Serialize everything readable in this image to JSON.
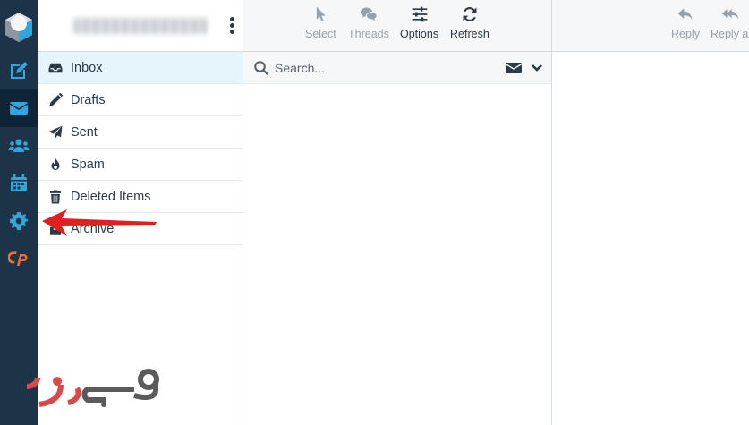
{
  "rail": {
    "items": [
      {
        "name": "compose",
        "icon": "edit-square-icon"
      },
      {
        "name": "mail",
        "icon": "envelope-icon"
      },
      {
        "name": "contacts",
        "icon": "users-icon"
      },
      {
        "name": "calendar",
        "icon": "calendar-icon"
      },
      {
        "name": "settings",
        "icon": "gear-icon"
      },
      {
        "name": "cpanel",
        "icon": "cpanel-icon"
      }
    ],
    "active": "mail",
    "colors": {
      "background": "#1d3347",
      "icon": "#2fa6dc",
      "cpanel": "#ff6c2c"
    }
  },
  "account": {
    "name_blurred": true
  },
  "folders": [
    {
      "label": "Inbox",
      "icon": "inbox-icon",
      "selected": true
    },
    {
      "label": "Drafts",
      "icon": "pencil-icon"
    },
    {
      "label": "Sent",
      "icon": "paper-plane-icon"
    },
    {
      "label": "Spam",
      "icon": "fire-icon"
    },
    {
      "label": "Deleted Items",
      "icon": "trash-icon"
    },
    {
      "label": "Archive",
      "icon": "archive-icon"
    }
  ],
  "toolbar": {
    "select_label": "Select",
    "threads_label": "Threads",
    "options_label": "Options",
    "refresh_label": "Refresh",
    "reply_label": "Reply",
    "reply_all_label": "Reply all"
  },
  "search": {
    "placeholder": "Search...",
    "value": ""
  },
  "watermark": {
    "text": "وب رمز",
    "colors": [
      "#d84a4a",
      "#5b5b5b"
    ]
  },
  "annotation": {
    "color": "#e02020",
    "points_to": "settings"
  }
}
